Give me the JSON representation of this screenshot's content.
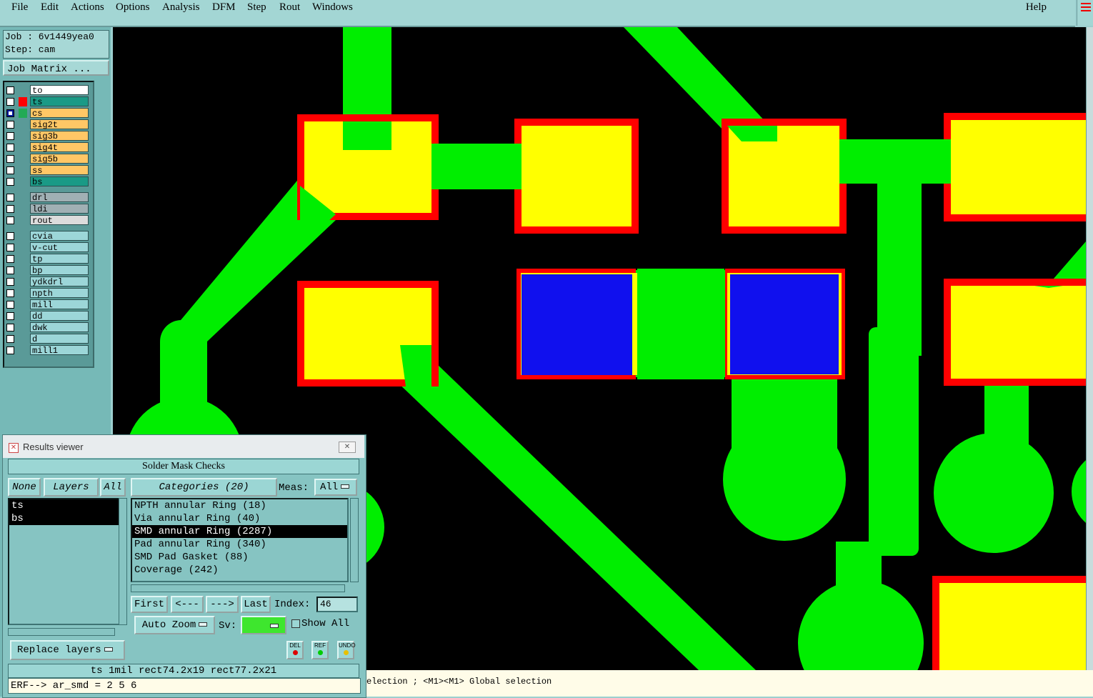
{
  "menu": {
    "items": [
      "File",
      "Edit",
      "Actions",
      "Options",
      "Analysis",
      "DFM",
      "Step",
      "Rout",
      "Windows"
    ],
    "help": "Help"
  },
  "job": {
    "job_label": "Job : 6v1449yea0",
    "step_label": "Step: cam",
    "matrix_button": "Job Matrix ..."
  },
  "layers": [
    {
      "name": "to",
      "color": "#ffffff"
    },
    {
      "name": "ts",
      "color": "#1a9a86"
    },
    {
      "name": "cs",
      "color": "#ffc766"
    },
    {
      "name": "sig2t",
      "color": "#ffc766"
    },
    {
      "name": "sig3b",
      "color": "#ffc766"
    },
    {
      "name": "sig4t",
      "color": "#ffc766"
    },
    {
      "name": "sig5b",
      "color": "#ffc766"
    },
    {
      "name": "ss",
      "color": "#ffc766"
    },
    {
      "name": "bs",
      "color": "#1a9a86"
    },
    {
      "name": "drl",
      "color": "#a0b0b4"
    },
    {
      "name": "ldi",
      "color": "#a0b0b4"
    },
    {
      "name": "rout",
      "color": "#dcdcdc"
    },
    {
      "name": "cvia",
      "color": "#9cd6d8"
    },
    {
      "name": "v-cut",
      "color": "#9cd6d8"
    },
    {
      "name": "tp",
      "color": "#9cd6d8"
    },
    {
      "name": "bp",
      "color": "#9cd6d8"
    },
    {
      "name": "ydkdrl",
      "color": "#9cd6d8"
    },
    {
      "name": "npth",
      "color": "#9cd6d8"
    },
    {
      "name": "mill",
      "color": "#9cd6d8"
    },
    {
      "name": "dd",
      "color": "#9cd6d8"
    },
    {
      "name": "dwk",
      "color": "#9cd6d8"
    },
    {
      "name": "d",
      "color": "#9cd6d8"
    },
    {
      "name": "mill1",
      "color": "#9cd6d8"
    }
  ],
  "results_viewer": {
    "title": "Results viewer",
    "header": "Solder Mask Checks",
    "none_button": "None",
    "layers_button": "Layers",
    "all_button": "All",
    "categories_button": "Categories (20)",
    "meas_label": "Meas:",
    "meas_value": "All",
    "layer_items": [
      "ts",
      "bs"
    ],
    "categories": [
      "NPTH annular Ring (18)",
      "Via annular Ring (40)",
      "SMD annular Ring (2287)",
      "Pad annular Ring (340)",
      "SMD Pad Gasket (88)",
      "Coverage (242)"
    ],
    "selected_category": 2,
    "first_button": "First",
    "prev_button": "<---",
    "next_button": "--->",
    "last_button": "Last",
    "index_label": "Index:",
    "index_value": "46",
    "autozoom_button": "Auto Zoom",
    "sv_label": "Sv:",
    "sv_color": "#3ee62e",
    "showall_label": "Show All",
    "replace_button": "Replace layers",
    "del_label": "DEL",
    "ref_label": "REF",
    "undo_label": "UNDO",
    "summary": "ts 1mil  rect74.2x19  rect77.2x21",
    "erf": "ERF--> ar_smd = 2 5 6"
  },
  "status": {
    "text": "election ; <M1><M1> Global selection"
  },
  "colors": {
    "copper": "#00ee00",
    "pad": "#ffff00",
    "mask": "#ff0000",
    "highlight": "#1010ee",
    "background": "#000000"
  }
}
